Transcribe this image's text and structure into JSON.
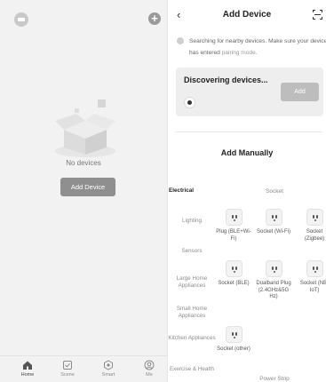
{
  "home": {
    "empty_text": "No devices",
    "add_button": "Add Device",
    "tabs": [
      {
        "label": "Home",
        "icon": "home-icon",
        "active": true
      },
      {
        "label": "Scene",
        "icon": "scene-icon",
        "active": false
      },
      {
        "label": "Smart",
        "icon": "smart-icon",
        "active": false
      },
      {
        "label": "Me",
        "icon": "profile-icon",
        "active": false
      }
    ]
  },
  "add_device": {
    "title": "Add Device",
    "search_text": "Searching for nearby devices. Make sure your device has entered ",
    "search_link": "pairing mode.",
    "discover_title": "Discovering devices...",
    "discover_add": "Add",
    "manual_title": "Add Manually",
    "categories": [
      "Electrical",
      "Lighting",
      "Sensors",
      "Large Home Appliances",
      "Small Home Appliances",
      "Kitchen Appliances",
      "Exercise & Health"
    ],
    "active_category": "Electrical",
    "section_title": "Socket",
    "devices": [
      "Plug (BLE+Wi-Fi)",
      "Socket (Wi-Fi)",
      "Socket (Zigbee)",
      "Socket (BLE)",
      "Dualband Plug (2.4GHz&5G Hz)",
      "Socket (NB-IoT)",
      "Socket (other)"
    ],
    "next_section": "Power Strip"
  },
  "colors": {
    "panel_gray": "#f2f2f2",
    "button_gray": "#8f8f8f",
    "disabled_gray": "#bdbdbd"
  }
}
